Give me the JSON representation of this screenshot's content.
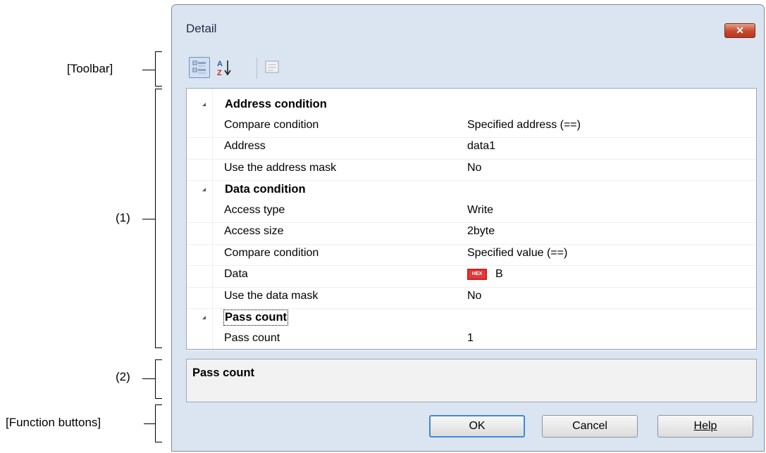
{
  "annotations": {
    "toolbar": "[Toolbar]",
    "property_area": "(1)",
    "description_area": "(2)",
    "function_buttons": "[Function buttons]"
  },
  "window": {
    "title": "Detail",
    "close_glyph": "✕"
  },
  "toolbar": {
    "buttons": [
      {
        "icon": "categorized-view-icon",
        "active": true
      },
      {
        "icon": "sort-alphabetical-icon",
        "active": false
      },
      {
        "icon": "property-pages-icon",
        "active": false
      }
    ]
  },
  "grid": {
    "categories": [
      {
        "name": "Address condition",
        "props": [
          {
            "label": "Compare condition",
            "value": "Specified address (==)"
          },
          {
            "label": "Address",
            "value": "data1"
          },
          {
            "label": "Use the address mask",
            "value": "No"
          }
        ]
      },
      {
        "name": "Data condition",
        "props": [
          {
            "label": "Access type",
            "value": "Write"
          },
          {
            "label": "Access size",
            "value": "2byte"
          },
          {
            "label": "Compare condition",
            "value": "Specified value (==)"
          },
          {
            "label": "Data",
            "value": "B",
            "badge": "HEX"
          },
          {
            "label": "Use the data mask",
            "value": "No"
          }
        ]
      },
      {
        "name": "Pass count",
        "props": [
          {
            "label": "Pass count",
            "value": "1"
          }
        ]
      }
    ]
  },
  "description": {
    "title": "Pass count"
  },
  "buttons": {
    "ok": "OK",
    "cancel": "Cancel",
    "help": "Help"
  },
  "colors": {
    "window_bg": "#dbe5f1",
    "close_button": "#c8482a",
    "default_button_border": "#3c8ad8"
  }
}
